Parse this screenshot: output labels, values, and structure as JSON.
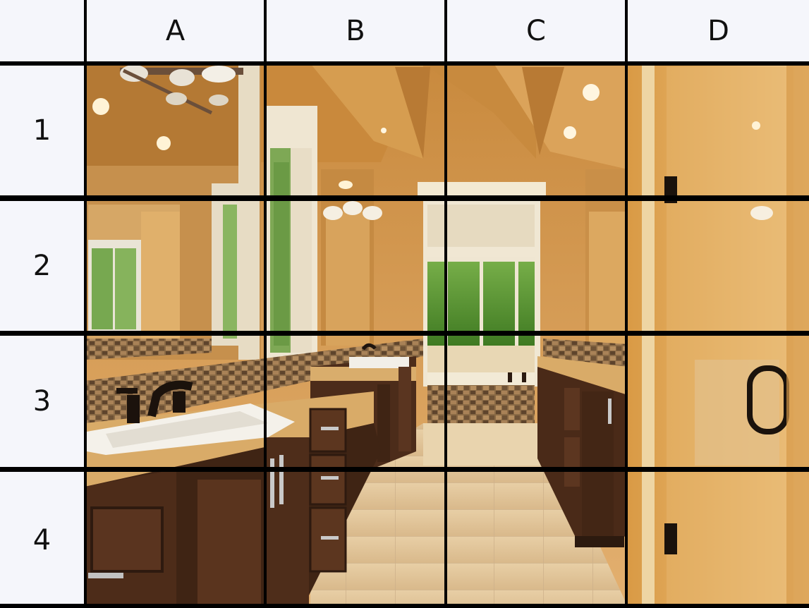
{
  "grid": {
    "columns": [
      "A",
      "B",
      "C",
      "D"
    ],
    "rows": [
      "1",
      "2",
      "3",
      "4"
    ]
  },
  "photo": {
    "subject": "master-bathroom-interior",
    "elements": [
      "vanity-sink-left",
      "vanity-sink-center",
      "wall-mirror",
      "vanity-light-fixture",
      "recessed-ceiling-lights",
      "soaking-tub",
      "window-with-trees",
      "glass-shower-door",
      "shower-door-handle",
      "wood-cabinets",
      "tile-floor",
      "stone-mosaic-backsplash"
    ],
    "colors": {
      "wall": "#d9a154",
      "ceiling": "#cf9648",
      "cabinet": "#4a2a18",
      "countertop": "#d7a866",
      "floor": "#e3c79c",
      "foliage": "#5f9a2f",
      "sink": "#f4f1ea",
      "gridline": "#000000",
      "header_bg": "#f5f6fb"
    }
  }
}
